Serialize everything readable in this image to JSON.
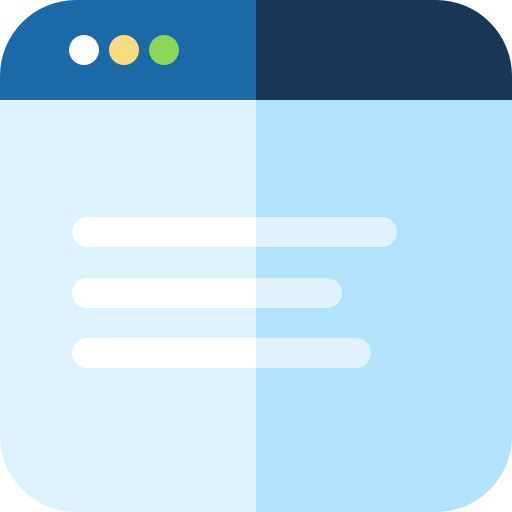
{
  "icon": {
    "name": "browser-window-icon",
    "colors": {
      "titlebar_left": "#1C69A7",
      "titlebar_right": "#1A3757",
      "body_left": "#DDF2FD",
      "body_right": "#B3E3FC",
      "text_line_left": "#FFFFFF",
      "text_line_right": "#E0F3FE"
    },
    "window_controls": [
      {
        "name": "close-dot",
        "color": "#FFFFFF"
      },
      {
        "name": "minimize-dot",
        "color": "#FDDA7F"
      },
      {
        "name": "maximize-dot",
        "color": "#8BD657"
      }
    ],
    "text_lines": [
      {
        "name": "text-line-1",
        "fill_fraction": 1.0
      },
      {
        "name": "text-line-2",
        "fill_fraction": 0.83
      },
      {
        "name": "text-line-3",
        "fill_fraction": 0.92
      }
    ]
  }
}
